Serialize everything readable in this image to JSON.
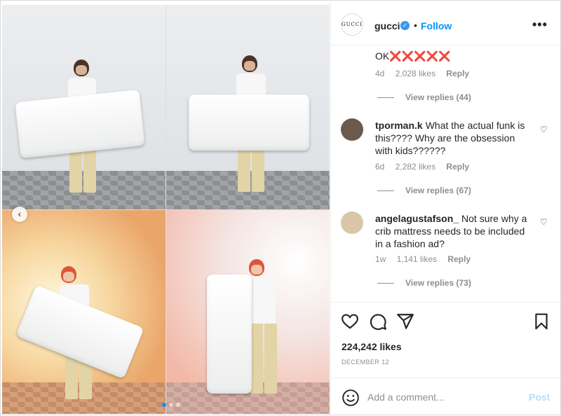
{
  "post": {
    "account": {
      "username": "gucci",
      "avatar_text": "GUCCI",
      "verified": true,
      "follow_label": "Follow",
      "separator": "•",
      "more_icon": "more-options-icon"
    },
    "media": {
      "carousel_prev_icon": "chevron-left-icon",
      "slide_count": 3,
      "active_slide": 1
    }
  },
  "comments": {
    "partial": {
      "text": "OK",
      "emoji": "❌❌❌❌❌",
      "time": "4d",
      "likes": "2,028 likes",
      "reply": "Reply",
      "view_replies": "View replies (44)"
    },
    "items": [
      {
        "user": "tporman.k",
        "text": "What the actual funk is this???? Why are the obsession with kids??????",
        "time": "6d",
        "likes": "2,282 likes",
        "reply": "Reply",
        "view_replies": "View replies (67)",
        "avatar_color": "#6b5a4c"
      },
      {
        "user": "angelagustafson_",
        "text": "Not sure why a crib mattress needs to be included in a fashion ad?",
        "time": "1w",
        "likes": "1,141 likes",
        "reply": "Reply",
        "view_replies": "View replies (73)",
        "avatar_color": "#d9c6a8"
      }
    ]
  },
  "actions": {
    "icons": [
      "heart-icon",
      "comment-icon",
      "share-icon",
      "bookmark-icon"
    ],
    "likes": "224,242 likes",
    "date": "DECEMBER 12"
  },
  "add_comment": {
    "placeholder": "Add a comment...",
    "post_label": "Post",
    "emoji_icon": "emoji-icon"
  },
  "colors": {
    "accent": "#0095f6",
    "verified": "#3897f0",
    "muted": "#8e8e8e",
    "post_disabled": "#b2dffc"
  }
}
